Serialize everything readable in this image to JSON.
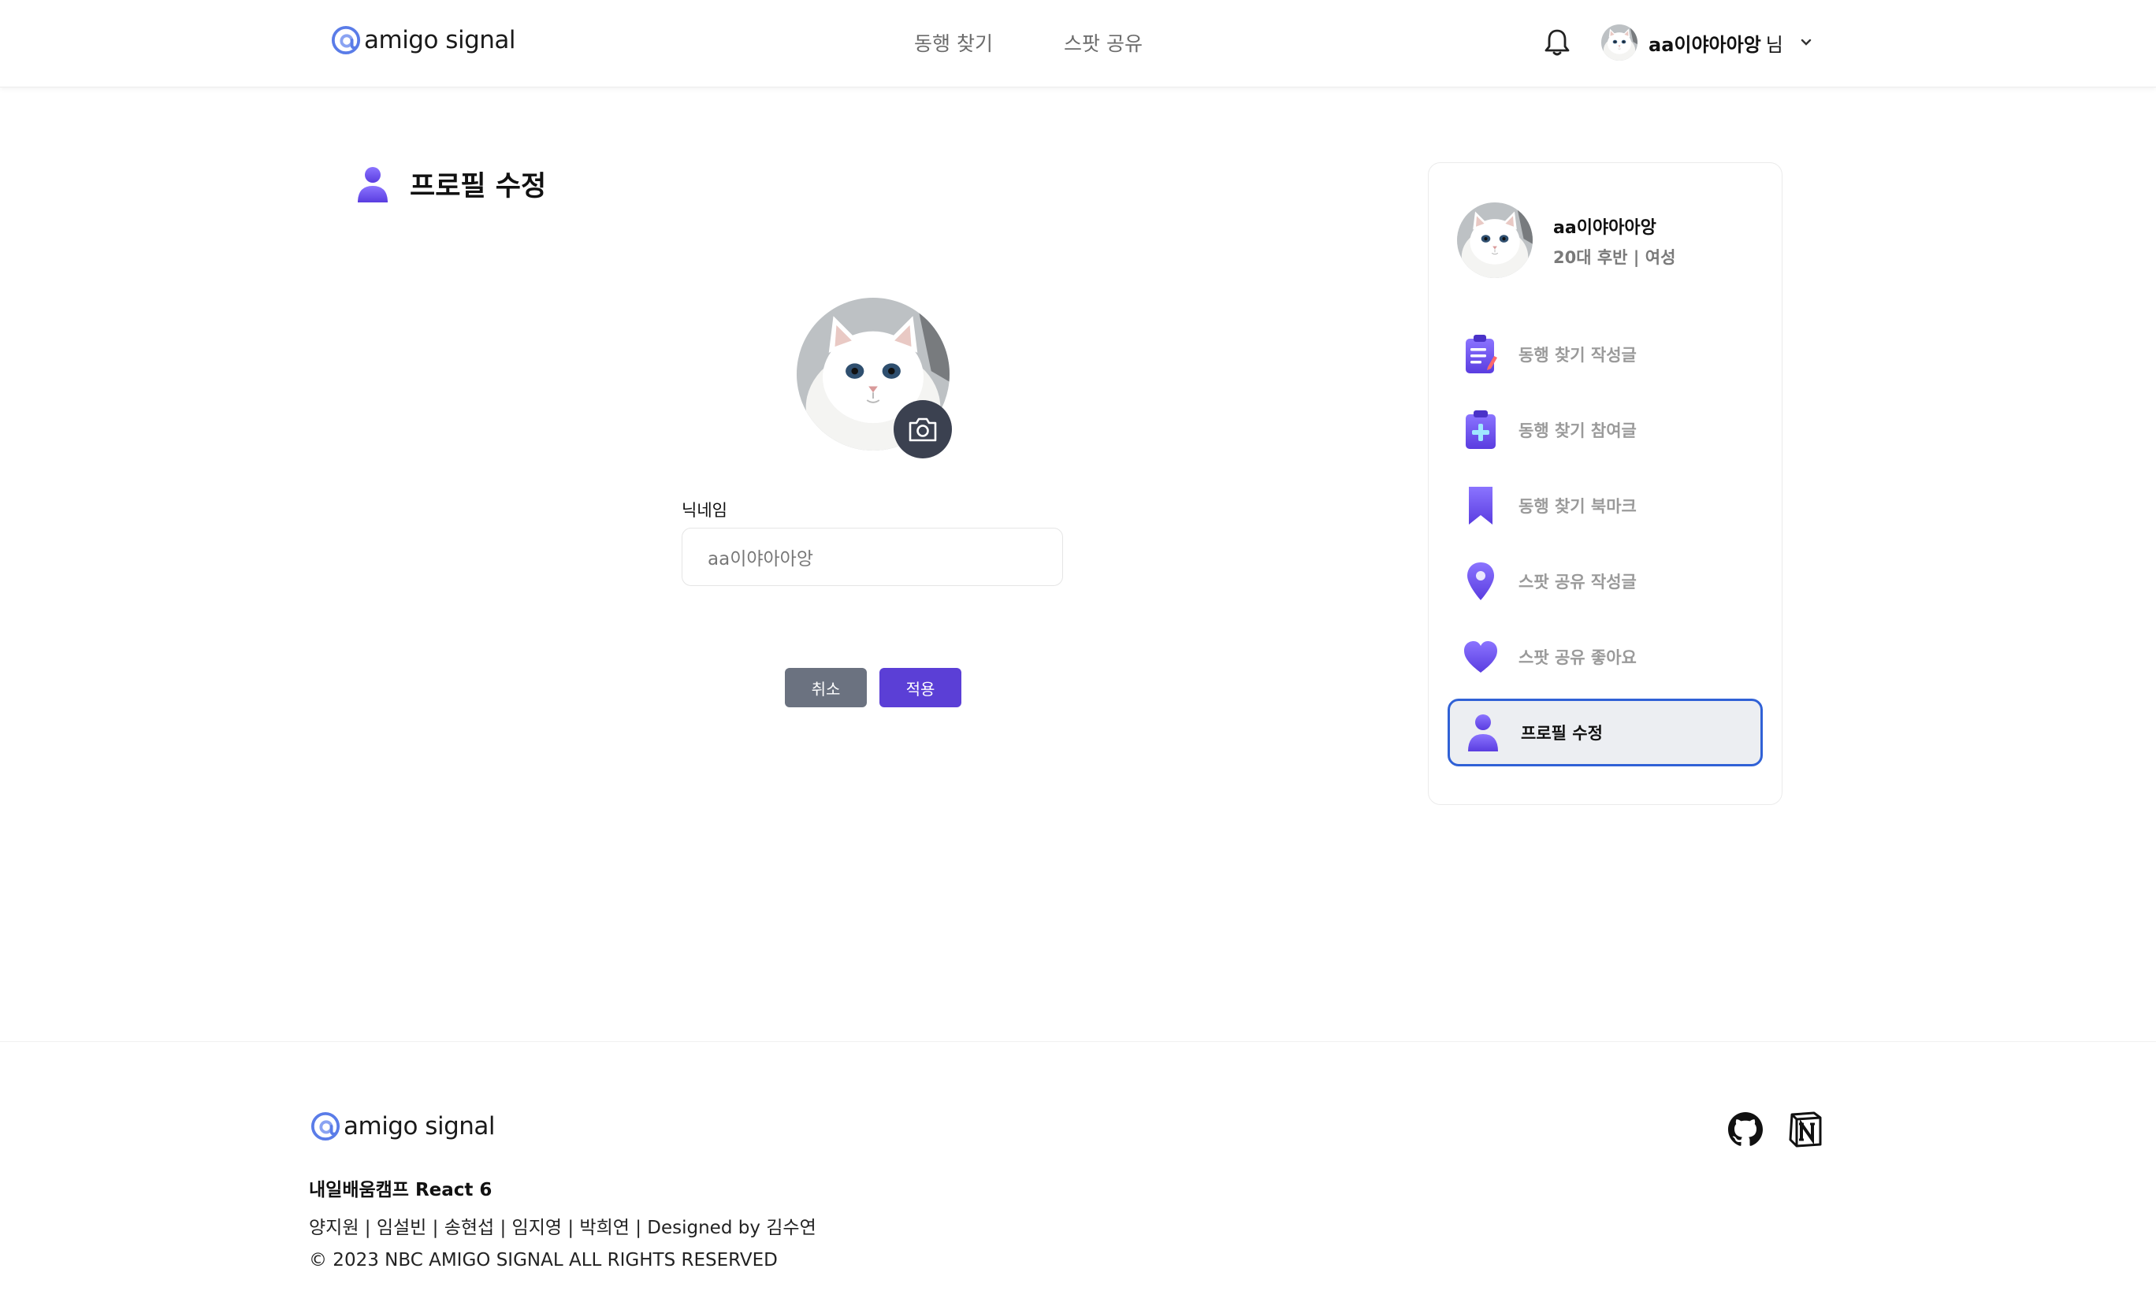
{
  "header": {
    "logo_text": "amigo signal",
    "nav": [
      "동행 찾기",
      "스팟 공유"
    ],
    "user_name": "aa이야아아앙",
    "user_suffix": "님"
  },
  "main": {
    "title": "프로필 수정",
    "nickname_label": "닉네임",
    "nickname_value": "aa이야아아앙",
    "cancel_label": "취소",
    "apply_label": "적용"
  },
  "sidebar": {
    "name": "aa이야아아앙",
    "meta": "20대 후반 | 여성",
    "menu": [
      {
        "label": "동행 찾기 작성글",
        "icon": "clipboard-pen-icon"
      },
      {
        "label": "동행 찾기 참여글",
        "icon": "clipboard-plus-icon"
      },
      {
        "label": "동행 찾기 북마크",
        "icon": "bookmark-icon"
      },
      {
        "label": "스팟 공유 작성글",
        "icon": "location-pin-icon"
      },
      {
        "label": "스팟 공유 좋아요",
        "icon": "heart-icon"
      },
      {
        "label": "프로필 수정",
        "icon": "user-icon",
        "active": true
      }
    ]
  },
  "footer": {
    "logo_text": "amigo signal",
    "camp": "내일배움캠프 React 6",
    "members": "양지원 | 임설빈 | 송현섭 | 임지영 | 박희연 | Designed by 김수연",
    "copyright": "© 2023 NBC AMIGO SIGNAL ALL RIGHTS RESERVED"
  },
  "colors": {
    "accent": "#5b3fd6",
    "cancel": "#6b7280",
    "active_border": "#3061d6",
    "icon_purple": "#6d4ff0"
  }
}
